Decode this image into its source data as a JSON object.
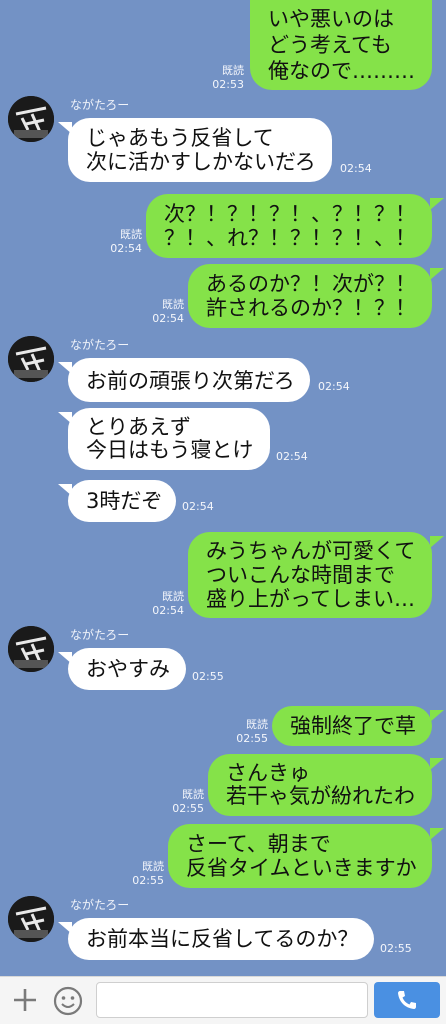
{
  "chat": {
    "sender_name": "ながたろー",
    "read_label": "既読",
    "messages": [
      {
        "from": "me",
        "lines": [
          "いや悪いのは",
          "どう考えても",
          "俺なので………"
        ],
        "time": "02:53"
      },
      {
        "from": "them",
        "lines": [
          "じゃあもう反省して",
          "次に活かすしかないだろ"
        ],
        "time": "02:54"
      },
      {
        "from": "me",
        "lines": [
          "次？！？！？！、？！？！",
          "？！、れ？！？！？！、！"
        ],
        "time": "02:54"
      },
      {
        "from": "me",
        "lines": [
          "あるのか？！次が？！",
          "許されるのか？！？！"
        ],
        "time": "02:54"
      },
      {
        "from": "them",
        "lines": [
          "お前の頑張り次第だろ"
        ],
        "time": "02:54"
      },
      {
        "from": "them",
        "lines": [
          "とりあえず",
          "今日はもう寝とけ"
        ],
        "time": "02:54"
      },
      {
        "from": "them",
        "lines": [
          "3時だぞ"
        ],
        "time": "02:54"
      },
      {
        "from": "me",
        "lines": [
          "みうちゃんが可愛くて",
          "ついこんな時間まで",
          "盛り上がってしまい…"
        ],
        "time": "02:54"
      },
      {
        "from": "them",
        "lines": [
          "おやすみ"
        ],
        "time": "02:55"
      },
      {
        "from": "me",
        "lines": [
          "強制終了で草"
        ],
        "time": "02:55"
      },
      {
        "from": "me",
        "lines": [
          "さんきゅ",
          "若干ゃ気が紛れたわ"
        ],
        "time": "02:55"
      },
      {
        "from": "me",
        "lines": [
          "さーて、朝まで",
          "反省タイムといきますか"
        ],
        "time": "02:55"
      },
      {
        "from": "them",
        "lines": [
          "お前本当に反省してるのか？"
        ],
        "time": "02:55"
      }
    ]
  },
  "input_bar": {
    "plus_icon": "plus-icon",
    "emoji_icon": "emoji-icon",
    "send_icon": "phone-icon",
    "message_value": "",
    "accent_color": "#4a90e2"
  },
  "colors": {
    "background": "#7392c5",
    "my_bubble": "#85e249",
    "their_bubble": "#ffffff"
  }
}
